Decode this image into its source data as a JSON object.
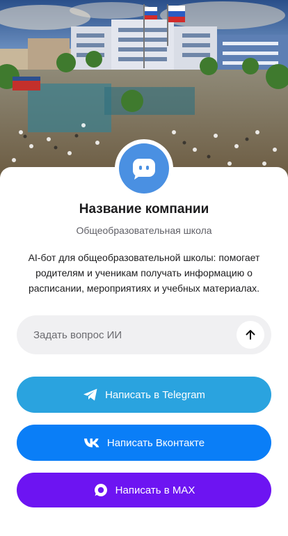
{
  "company": {
    "name": "Название компании",
    "type": "Общеобразовательная школа",
    "description": "AI-бот для общеобразовательной школы: помогает родителям и ученикам получать информацию о расписании, мероприятиях и учебных материалах."
  },
  "ask": {
    "placeholder": "Задать вопрос ИИ",
    "value": ""
  },
  "buttons": {
    "telegram_label": "Написать в Telegram",
    "vk_label": "Написать Вконтакте",
    "max_label": "Написать в MAX"
  },
  "colors": {
    "avatar": "#4a90e2",
    "telegram": "#2aa3df",
    "vk": "#0a7ef7",
    "max": "#6d14f2"
  },
  "icons": {
    "avatar": "chat-bubble-icon",
    "send": "arrow-up-icon",
    "telegram": "telegram-icon",
    "vk": "vk-icon",
    "max": "max-icon"
  }
}
